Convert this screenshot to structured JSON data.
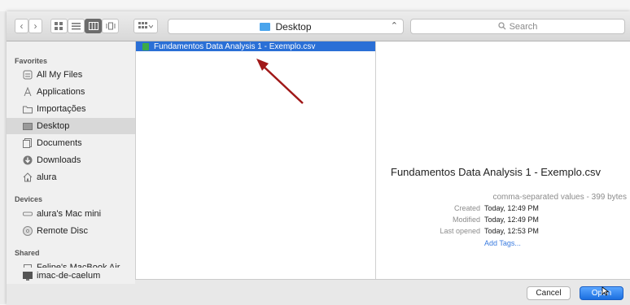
{
  "toolbar": {
    "location": "Desktop",
    "location_caret": "⌃",
    "search_placeholder": "Search",
    "back_icon": "‹",
    "forward_icon": "›"
  },
  "sidebar": {
    "favorites_label": "Favorites",
    "favorites": [
      {
        "label": "All My Files",
        "icon": "all-files-icon"
      },
      {
        "label": "Applications",
        "icon": "applications-icon"
      },
      {
        "label": "Importações",
        "icon": "folder-icon"
      },
      {
        "label": "Desktop",
        "icon": "desktop-icon"
      },
      {
        "label": "Documents",
        "icon": "documents-icon"
      },
      {
        "label": "Downloads",
        "icon": "downloads-icon"
      },
      {
        "label": "alura",
        "icon": "home-icon"
      }
    ],
    "devices_label": "Devices",
    "devices": [
      {
        "label": "alura's Mac mini",
        "icon": "mac-mini-icon"
      },
      {
        "label": "Remote Disc",
        "icon": "disc-icon"
      }
    ],
    "shared_label": "Shared",
    "shared": [
      {
        "label": "Felipe's MacBook Air",
        "icon": "laptop-icon"
      },
      {
        "label": "imac-de-caelum",
        "icon": "imac-icon"
      }
    ]
  },
  "file_list": {
    "selected_file": "Fundamentos Data Analysis 1 - Exemplo.csv"
  },
  "preview": {
    "title": "Fundamentos Data Analysis 1 - Exemplo.csv",
    "type": "comma-separated values - 399 bytes",
    "created_label": "Created",
    "created_value": "Today, 12:49 PM",
    "modified_label": "Modified",
    "modified_value": "Today, 12:49 PM",
    "last_opened_label": "Last opened",
    "last_opened_value": "Today, 12:53 PM",
    "add_tags": "Add Tags..."
  },
  "buttons": {
    "cancel": "Cancel",
    "open": "Open"
  }
}
